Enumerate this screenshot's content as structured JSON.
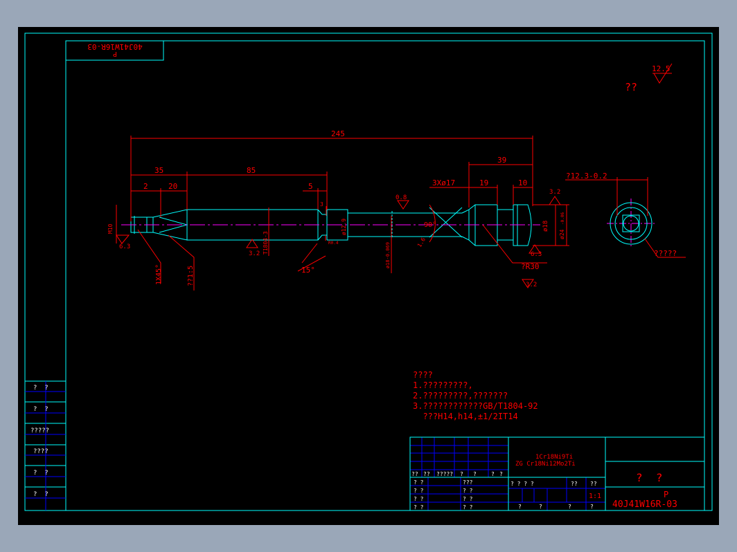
{
  "colors": {
    "background": "#000000",
    "frame": "#00ffff",
    "annotation": "#ff0000",
    "centerline": "#ff00ff",
    "table_lines": "#0000ff",
    "desktop": "#9aa7b8"
  },
  "drawing": {
    "top_box_line1": "P",
    "top_box_line2": "40J41W16R-03",
    "roughness_main": "12.5",
    "roughness_note": "??",
    "dimensions": {
      "overall": "245",
      "d35": "35",
      "d85": "85",
      "d2": "2",
      "d20": "20",
      "d5": "5",
      "d3": "3",
      "d39": "39",
      "d19": "19",
      "d10": "10",
      "holes": "3Xø17",
      "m10": "M10",
      "chamfer": "1X45°",
      "taper": "??1:5",
      "r04": "R0.4",
      "dia129": "ø12.9",
      "dia18": "ø18",
      "dia18_tol": "ø18-0.069",
      "dia24": "ø24",
      "dia24_tol": "-0.06",
      "angle15": "15°",
      "angle90": "90°",
      "r30": "?R30",
      "t1804": "T1804-3",
      "r08": "0.8",
      "r32a": "3.2",
      "r32b": "3.2",
      "r32c": "3.2",
      "r63a": "6.3",
      "r63b": "6.3",
      "r16": "1.6",
      "section_width": "?12.3-0.2",
      "section_note": "?????"
    },
    "notes": [
      "????",
      "1.?????????,",
      "2.?????????,???????",
      "3.????????????GB/T1804-92",
      "  ???H14,h14,±1/2IT14"
    ]
  },
  "left_table": {
    "rows": [
      "?  ?",
      "?  ?",
      "?????",
      "????",
      "?  ?",
      "?  ?"
    ]
  },
  "title_block": {
    "material_line1": "1Cr18Ni9Ti",
    "material_line2": "ZG Cr18Ni12Mo2Ti",
    "part_name": "?  ?",
    "drawing_prefix": "P",
    "drawing_number": "40J41W16R-03",
    "scale": "1:1",
    "hdr_row": [
      "??",
      "??",
      "?????",
      "?",
      "?",
      "?",
      "?"
    ],
    "rows_left": [
      "? ?",
      "? ?",
      "? ?",
      "? ?"
    ],
    "rows_mid": [
      "???",
      "? ?",
      "? ?",
      "? ?"
    ],
    "stage_row": [
      "? ? ? ?",
      "??",
      "??"
    ],
    "bottom_row": [
      "?",
      "?",
      "?",
      "?"
    ]
  }
}
